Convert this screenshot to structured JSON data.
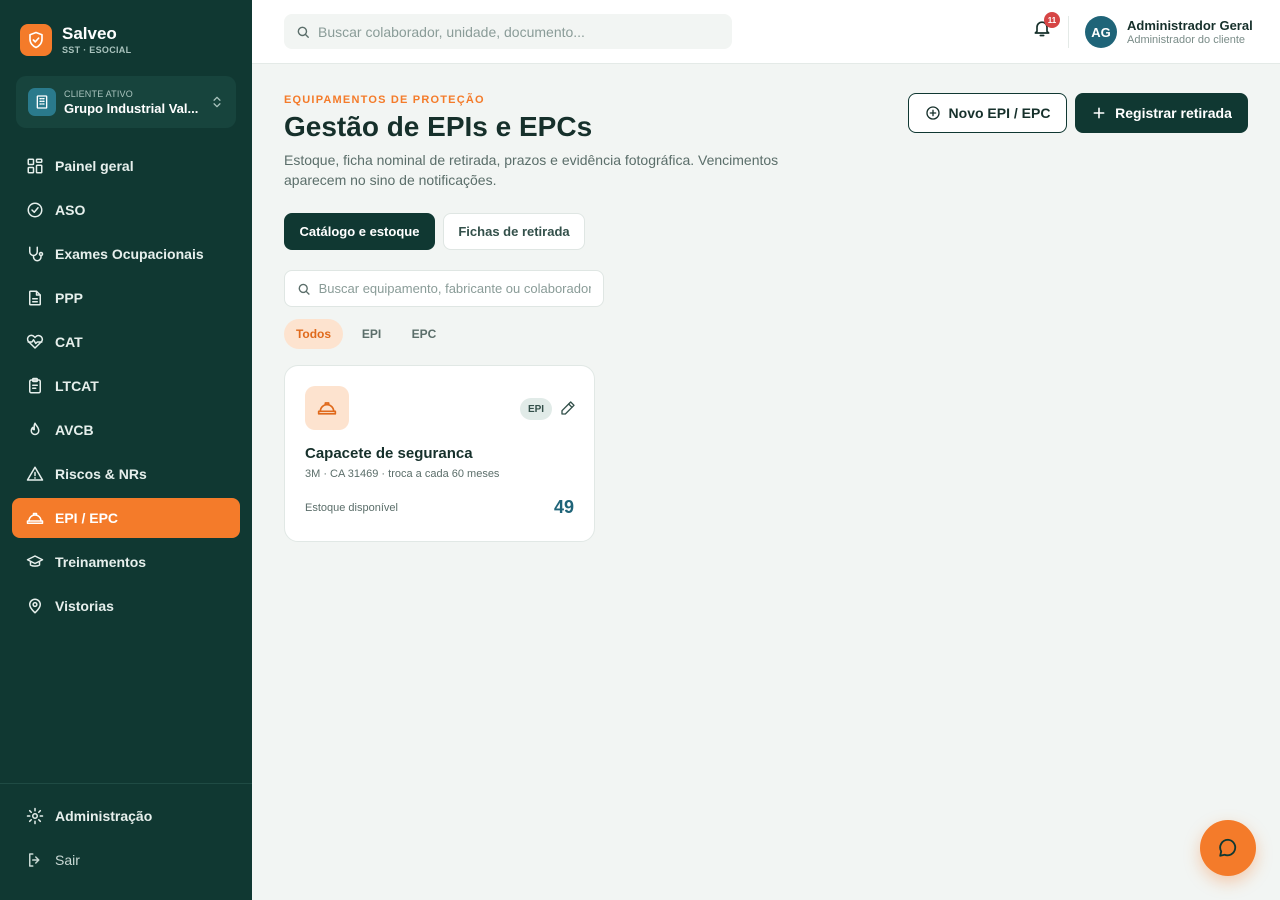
{
  "brand": {
    "name": "Salveo",
    "subtitle": "SST · ESOCIAL"
  },
  "client": {
    "label": "CLIENTE ATIVO",
    "name": "Grupo Industrial Val..."
  },
  "sidebar": {
    "items": [
      {
        "label": "Painel geral",
        "icon": "grid-icon"
      },
      {
        "label": "ASO",
        "icon": "check-circle-icon"
      },
      {
        "label": "Exames Ocupacionais",
        "icon": "stethoscope-icon"
      },
      {
        "label": "PPP",
        "icon": "document-icon"
      },
      {
        "label": "CAT",
        "icon": "heart-pulse-icon"
      },
      {
        "label": "LTCAT",
        "icon": "clipboard-icon"
      },
      {
        "label": "AVCB",
        "icon": "flame-icon"
      },
      {
        "label": "Riscos & NRs",
        "icon": "warning-icon"
      },
      {
        "label": "EPI / EPC",
        "icon": "hardhat-icon",
        "active": true
      },
      {
        "label": "Treinamentos",
        "icon": "graduation-cap-icon"
      },
      {
        "label": "Vistorias",
        "icon": "map-pin-icon"
      }
    ],
    "bottom": [
      {
        "label": "Administração",
        "icon": "gear-icon"
      },
      {
        "label": "Sair",
        "icon": "logout-icon"
      }
    ]
  },
  "topbar": {
    "search_placeholder": "Buscar colaborador, unidade, documento...",
    "notification_count": "11",
    "user": {
      "initials": "AG",
      "name": "Administrador Geral",
      "role": "Administrador do cliente"
    }
  },
  "page": {
    "eyebrow": "EQUIPAMENTOS DE PROTEÇÃO",
    "title": "Gestão de EPIs e EPCs",
    "description": "Estoque, ficha nominal de retirada, prazos e evidência fotográfica. Vencimentos aparecem no sino de notificações.",
    "actions": {
      "new_label": "Novo EPI / EPC",
      "register_label": "Registrar retirada"
    },
    "tabs": [
      "Catálogo e estoque",
      "Fichas de retirada"
    ],
    "search_placeholder": "Buscar equipamento, fabricante ou colaborador",
    "filters": [
      "Todos",
      "EPI",
      "EPC"
    ],
    "active_filter": "Todos"
  },
  "items": [
    {
      "name": "Capacete de seguranca",
      "meta": "3M · CA 31469 · troca a cada 60 meses",
      "type": "EPI",
      "stock_label": "Estoque disponível",
      "stock": "49"
    }
  ],
  "colors": {
    "sidebar": "#103832",
    "accent": "#f47b2a",
    "stock": "#1f6478"
  }
}
